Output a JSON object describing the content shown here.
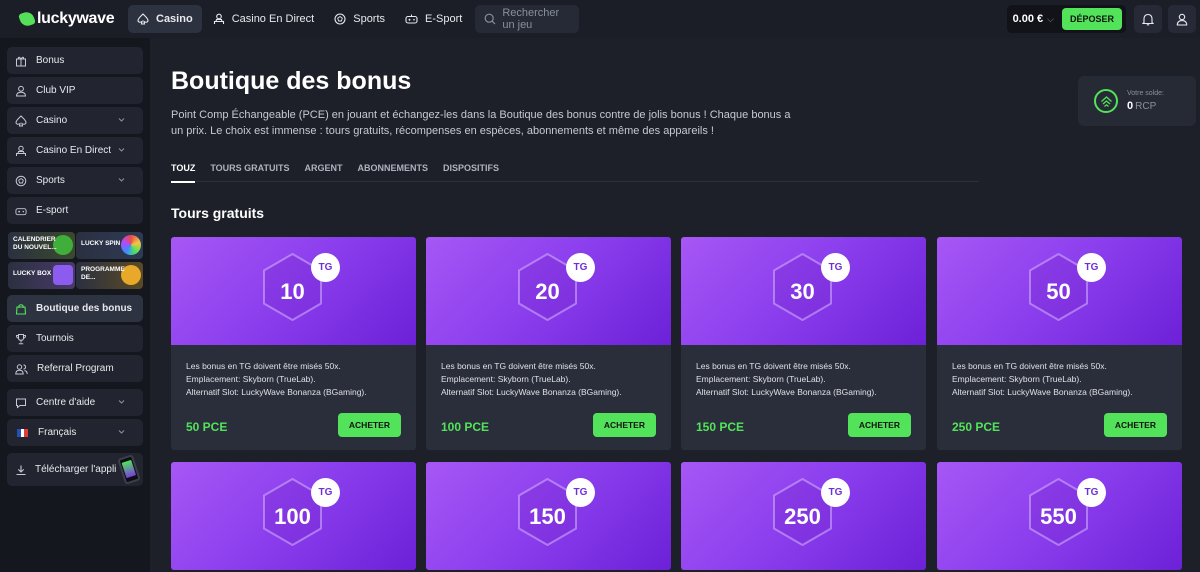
{
  "brand": {
    "name": "luckywave",
    "accent": "#52e35a",
    "purple": "#8d40ee"
  },
  "header": {
    "nav": [
      {
        "label": "Casino",
        "icon": "spade-icon"
      },
      {
        "label": "Casino En Direct",
        "icon": "dealer-icon"
      },
      {
        "label": "Sports",
        "icon": "ball-icon"
      },
      {
        "label": "E-Sport",
        "icon": "gamepad-icon"
      }
    ],
    "search_placeholder": "Rechercher un jeu",
    "balance": "0.00 €",
    "deposit_label": "DÉPOSER"
  },
  "sidebar": {
    "items": [
      {
        "label": "Bonus"
      },
      {
        "label": "Club VIP"
      },
      {
        "label": "Casino"
      },
      {
        "label": "Casino En Direct"
      },
      {
        "label": "Sports"
      },
      {
        "label": "E-sport"
      },
      {
        "label": "Boutique des bonus"
      },
      {
        "label": "Tournois"
      },
      {
        "label": "Referral Program"
      },
      {
        "label": "Centre d'aide"
      },
      {
        "label": "Français"
      }
    ],
    "promos": [
      "CALENDRIER DU NOUVEL...",
      "LUCKY SPIN",
      "LUCKY BOX",
      "PROGRAMME DE..."
    ],
    "download_label": "Télécharger l'appli"
  },
  "main": {
    "title": "Boutique des bonus",
    "description": "Point Comp Échangeable (PCE) en jouant et échangez-les dans la Boutique des bonus contre de jolis bonus ! Chaque bonus a un prix. Le choix est immense : tours gratuits, récompenses en espèces, abonnements et même des appareils !",
    "solde": {
      "label": "Votre solde:",
      "value": "0",
      "unit": "RCP"
    },
    "tabs": [
      "TOUZ",
      "TOURS GRATUITS",
      "ARGENT",
      "ABONNEMENTS",
      "DISPOSITIFS"
    ],
    "section_title": "Tours gratuits",
    "card_lines": [
      "Les bonus en TG doivent être misés 50x.",
      "Emplacement: Skyborn (TrueLab).",
      "Alternatif Slot: LuckyWave Bonanza (BGaming)."
    ],
    "badge": "TG",
    "buy_label": "ACHETER",
    "cards": [
      {
        "amount": "10",
        "price": "50 PCE"
      },
      {
        "amount": "20",
        "price": "100 PCE"
      },
      {
        "amount": "30",
        "price": "150 PCE"
      },
      {
        "amount": "50",
        "price": "250 PCE"
      },
      {
        "amount": "100"
      },
      {
        "amount": "150"
      },
      {
        "amount": "250"
      },
      {
        "amount": "550"
      }
    ]
  }
}
